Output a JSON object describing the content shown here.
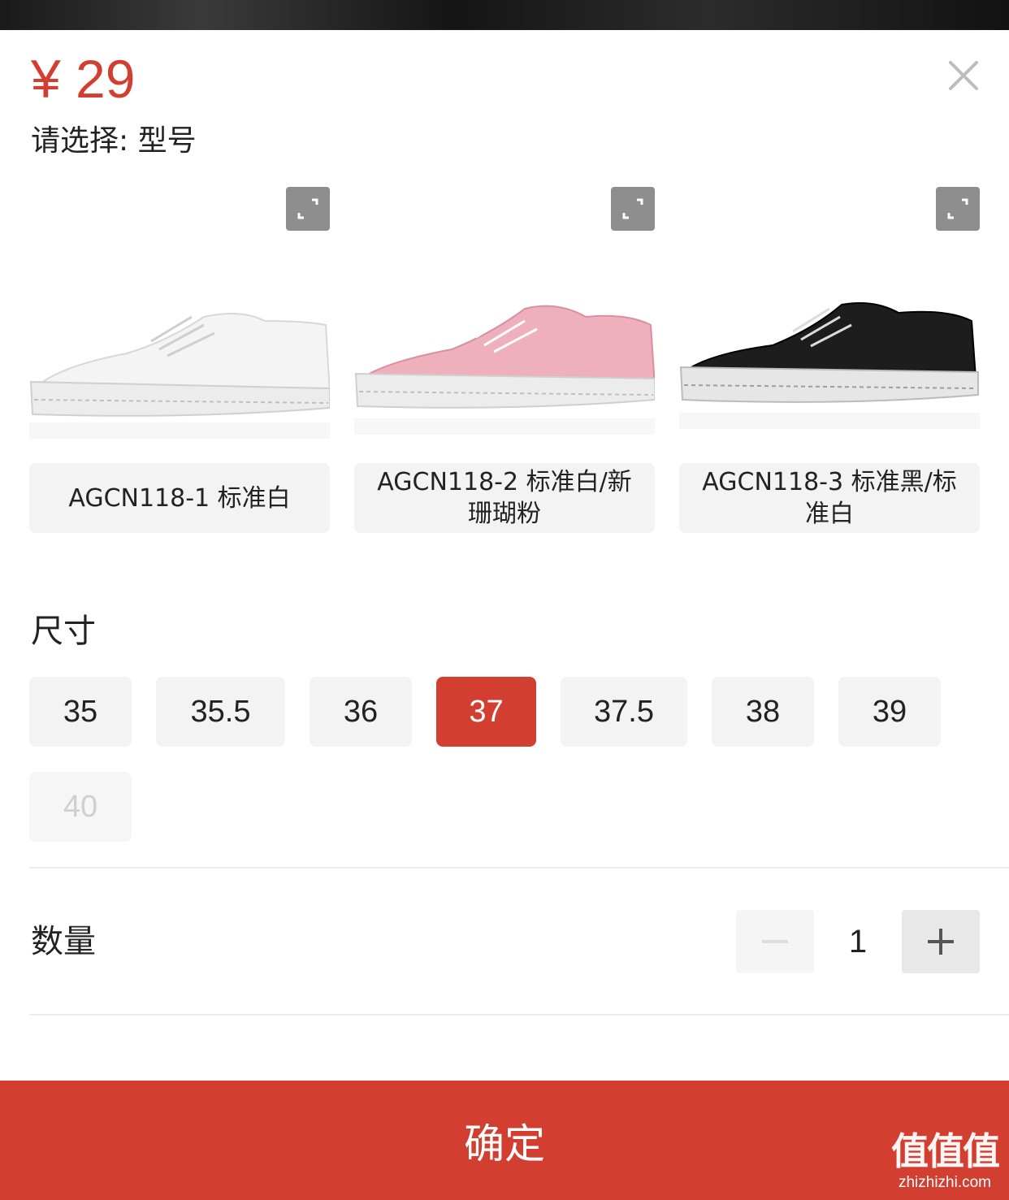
{
  "price": "¥ 29",
  "prompt": "请选择: 型号",
  "variants": [
    {
      "label": "AGCN118-1 标准白",
      "icon": "expand-icon"
    },
    {
      "label": "AGCN118-2 标准白/新珊瑚粉",
      "icon": "expand-icon"
    },
    {
      "label": "AGCN118-3 标准黑/标准白",
      "icon": "expand-icon"
    }
  ],
  "size": {
    "title": "尺寸",
    "options": [
      "35",
      "35.5",
      "36",
      "37",
      "37.5",
      "38",
      "39",
      "40"
    ],
    "selected": "37",
    "disabled": [
      "40"
    ]
  },
  "quantity": {
    "label": "数量",
    "value": "1"
  },
  "confirm_label": "确定",
  "watermark": {
    "logo": "值值值",
    "url": "zhizhizhi.com"
  },
  "colors": {
    "accent": "#d23f31",
    "chip_bg": "#f3f3f3",
    "shoe_white": "#f2f2f2",
    "shoe_pink": "#efb0bd",
    "shoe_black": "#1d1d1d"
  }
}
